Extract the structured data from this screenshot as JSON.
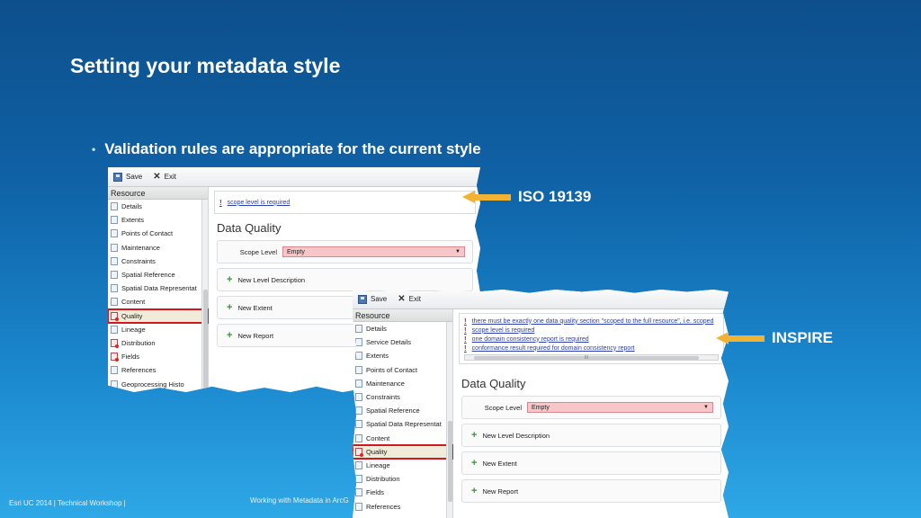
{
  "slide": {
    "title": "Setting your metadata style",
    "bullet": "Validation rules are appropriate for the current style",
    "footer_left": "Esri UC 2014 | Technical Workshop |",
    "footer_center": "Working with Metadata in ArcG"
  },
  "callouts": {
    "iso": "ISO 19139",
    "inspire": "INSPIRE",
    "arrow_color": "#f2b233"
  },
  "colors": {
    "background_top": "#0d4f8c",
    "background_bottom": "#2ea8e6",
    "error_red": "#d01b1b",
    "selection_outline": "#d0191e",
    "scope_invalid_fill": "#f7c6c9",
    "link_blue": "#2b3fb3"
  },
  "iso_screen": {
    "toolbar": {
      "save": "Save",
      "exit": "Exit"
    },
    "sidebar": {
      "header": "Resource",
      "items": [
        {
          "label": "Details",
          "icon": "document-icon"
        },
        {
          "label": "Extents",
          "icon": "document-icon"
        },
        {
          "label": "Points of Contact",
          "icon": "document-icon"
        },
        {
          "label": "Maintenance",
          "icon": "document-icon"
        },
        {
          "label": "Constraints",
          "icon": "document-icon"
        },
        {
          "label": "Spatial Reference",
          "icon": "document-icon"
        },
        {
          "label": "Spatial Data Representat",
          "icon": "document-icon"
        },
        {
          "label": "Content",
          "icon": "document-icon"
        },
        {
          "label": "Quality",
          "icon": "document-error-icon",
          "selected": true
        },
        {
          "label": "Lineage",
          "icon": "document-icon"
        },
        {
          "label": "Distribution",
          "icon": "document-error-icon"
        },
        {
          "label": "Fields",
          "icon": "document-error-icon"
        },
        {
          "label": "References",
          "icon": "document-icon"
        },
        {
          "label": "Geoprocessing Histo",
          "icon": "document-icon"
        }
      ]
    },
    "messages": [
      "scope level is required"
    ],
    "section_title": "Data Quality",
    "scope": {
      "label": "Scope Level",
      "value": "Empty"
    },
    "cards": [
      "New Level Description",
      "New Extent",
      "New Report"
    ]
  },
  "inspire_screen": {
    "toolbar": {
      "save": "Save",
      "exit": "Exit"
    },
    "sidebar": {
      "header": "Resource",
      "items": [
        {
          "label": "Details",
          "icon": "document-icon"
        },
        {
          "label": "Service Details",
          "icon": "document-icon"
        },
        {
          "label": "Extents",
          "icon": "document-icon"
        },
        {
          "label": "Points of Contact",
          "icon": "document-icon"
        },
        {
          "label": "Maintenance",
          "icon": "document-icon"
        },
        {
          "label": "Constraints",
          "icon": "document-icon"
        },
        {
          "label": "Spatial Reference",
          "icon": "document-icon"
        },
        {
          "label": "Spatial Data Representat",
          "icon": "document-icon"
        },
        {
          "label": "Content",
          "icon": "document-icon"
        },
        {
          "label": "Quality",
          "icon": "document-error-icon",
          "selected": true
        },
        {
          "label": "Lineage",
          "icon": "document-icon"
        },
        {
          "label": "Distribution",
          "icon": "document-icon"
        },
        {
          "label": "Fields",
          "icon": "document-icon"
        },
        {
          "label": "References",
          "icon": "document-icon"
        }
      ]
    },
    "messages": [
      "there must be exactly one data quality section \"scoped to the full resource\", i.e. scoped",
      "scope level is required",
      "one domain consistency report is required",
      "conformance result required for domain consistency report"
    ],
    "scroll_grip": "III",
    "section_title": "Data Quality",
    "scope": {
      "label": "Scope Level",
      "value": "Empty"
    },
    "cards": [
      "New Level Description",
      "New Extent",
      "New Report"
    ]
  }
}
